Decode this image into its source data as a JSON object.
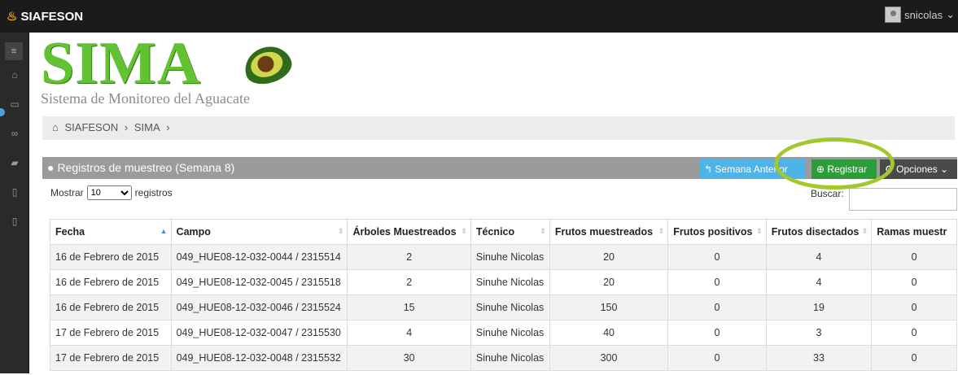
{
  "topbar": {
    "brand": "SIAFESON",
    "user_name": "snicolas"
  },
  "logo": {
    "title": "SIMA",
    "subtitle": "Sistema de Monitoreo del Aguacate"
  },
  "breadcrumb": [
    "SIAFESON",
    "SIMA"
  ],
  "panel": {
    "title": "Registros de muestreo (Semana 8)",
    "btn_prev": "Semana Anterior",
    "btn_register": "Registrar",
    "btn_options": "Opciones"
  },
  "controls": {
    "show_label": "Mostrar",
    "show_value": "10",
    "records_label": "registros",
    "search_label": "Buscar:"
  },
  "table": {
    "headers": [
      "Fecha",
      "Campo",
      "Árboles Muestreados",
      "Técnico",
      "Frutos muestreados",
      "Frutos positivos",
      "Frutos disectados",
      "Ramas muestr"
    ],
    "rows": [
      [
        "16 de Febrero de 2015",
        "049_HUE08-12-032-0044 / 2315514",
        "2",
        "Sinuhe Nicolas",
        "20",
        "0",
        "4",
        "0"
      ],
      [
        "16 de Febrero de 2015",
        "049_HUE08-12-032-0045 / 2315518",
        "2",
        "Sinuhe Nicolas",
        "20",
        "0",
        "4",
        "0"
      ],
      [
        "16 de Febrero de 2015",
        "049_HUE08-12-032-0046 / 2315524",
        "15",
        "Sinuhe Nicolas",
        "150",
        "0",
        "19",
        "0"
      ],
      [
        "17 de Febrero de 2015",
        "049_HUE08-12-032-0047 / 2315530",
        "4",
        "Sinuhe Nicolas",
        "40",
        "0",
        "3",
        "0"
      ],
      [
        "17 de Febrero de 2015",
        "049_HUE08-12-032-0048 / 2315532",
        "30",
        "Sinuhe Nicolas",
        "300",
        "0",
        "33",
        "0"
      ]
    ]
  },
  "colors": {
    "topbar": "#1b1b1b",
    "accent_green": "#2d9c3a",
    "accent_blue": "#4fb3e8",
    "highlight": "#a4c72c"
  }
}
